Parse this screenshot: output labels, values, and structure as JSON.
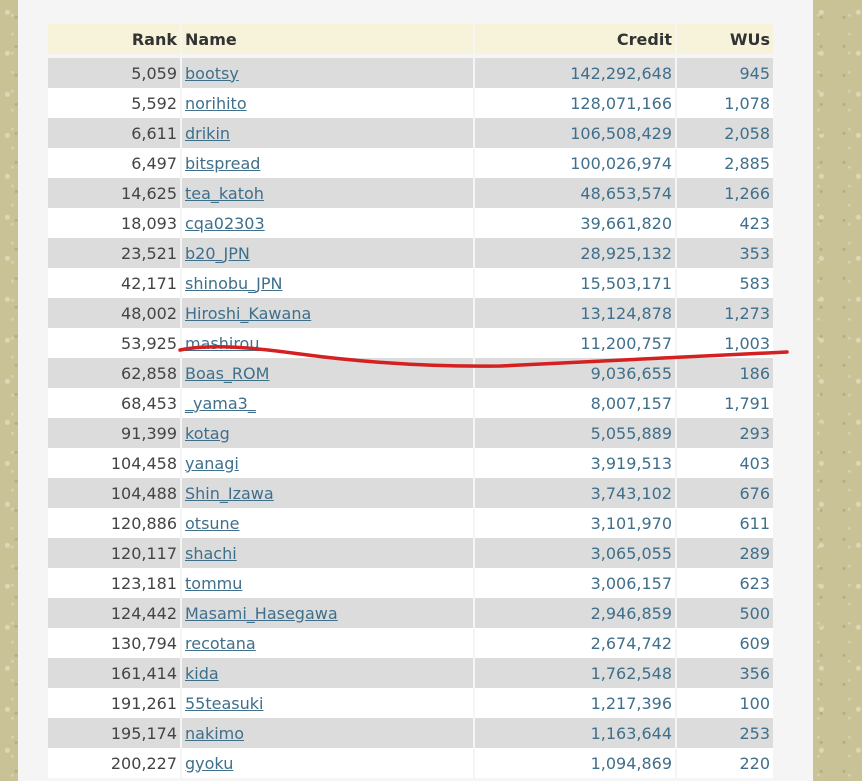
{
  "table": {
    "headers": {
      "rank": "Rank",
      "name": "Name",
      "credit": "Credit",
      "wus": "WUs"
    },
    "rows": [
      {
        "rank": "5,059",
        "name": "bootsy",
        "credit": "142,292,648",
        "wus": "945"
      },
      {
        "rank": "5,592",
        "name": "norihito",
        "credit": "128,071,166",
        "wus": "1,078"
      },
      {
        "rank": "6,611",
        "name": "drikin",
        "credit": "106,508,429",
        "wus": "2,058"
      },
      {
        "rank": "6,497",
        "name": "bitspread",
        "credit": "100,026,974",
        "wus": "2,885"
      },
      {
        "rank": "14,625",
        "name": "tea_katoh",
        "credit": "48,653,574",
        "wus": "1,266"
      },
      {
        "rank": "18,093",
        "name": "cqa02303",
        "credit": "39,661,820",
        "wus": "423"
      },
      {
        "rank": "23,521",
        "name": "b20_JPN",
        "credit": "28,925,132",
        "wus": "353"
      },
      {
        "rank": "42,171",
        "name": "shinobu_JPN",
        "credit": "15,503,171",
        "wus": "583"
      },
      {
        "rank": "48,002",
        "name": "Hiroshi_Kawana",
        "credit": "13,124,878",
        "wus": "1,273"
      },
      {
        "rank": "53,925",
        "name": "mashirou",
        "credit": "11,200,757",
        "wus": "1,003"
      },
      {
        "rank": "62,858",
        "name": "Boas_ROM",
        "credit": "9,036,655",
        "wus": "186"
      },
      {
        "rank": "68,453",
        "name": "_yama3_",
        "credit": "8,007,157",
        "wus": "1,791"
      },
      {
        "rank": "91,399",
        "name": "kotag",
        "credit": "5,055,889",
        "wus": "293"
      },
      {
        "rank": "104,458",
        "name": "yanagi",
        "credit": "3,919,513",
        "wus": "403"
      },
      {
        "rank": "104,488",
        "name": "Shin_Izawa",
        "credit": "3,743,102",
        "wus": "676"
      },
      {
        "rank": "120,886",
        "name": "otsune",
        "credit": "3,101,970",
        "wus": "611"
      },
      {
        "rank": "120,117",
        "name": "shachi",
        "credit": "3,065,055",
        "wus": "289"
      },
      {
        "rank": "123,181",
        "name": "tommu",
        "credit": "3,006,157",
        "wus": "623"
      },
      {
        "rank": "124,442",
        "name": "Masami_Hasegawa",
        "credit": "2,946,859",
        "wus": "500"
      },
      {
        "rank": "130,794",
        "name": "recotana",
        "credit": "2,674,742",
        "wus": "609"
      },
      {
        "rank": "161,414",
        "name": "kida",
        "credit": "1,762,548",
        "wus": "356"
      },
      {
        "rank": "191,261",
        "name": "55teasuki",
        "credit": "1,217,396",
        "wus": "100"
      },
      {
        "rank": "195,174",
        "name": "nakimo",
        "credit": "1,163,644",
        "wus": "253"
      },
      {
        "rank": "200,227",
        "name": "gyoku",
        "credit": "1,094,869",
        "wus": "220"
      }
    ]
  },
  "annotation": {
    "color": "#d42020",
    "highlighted_user": "mashirou"
  }
}
